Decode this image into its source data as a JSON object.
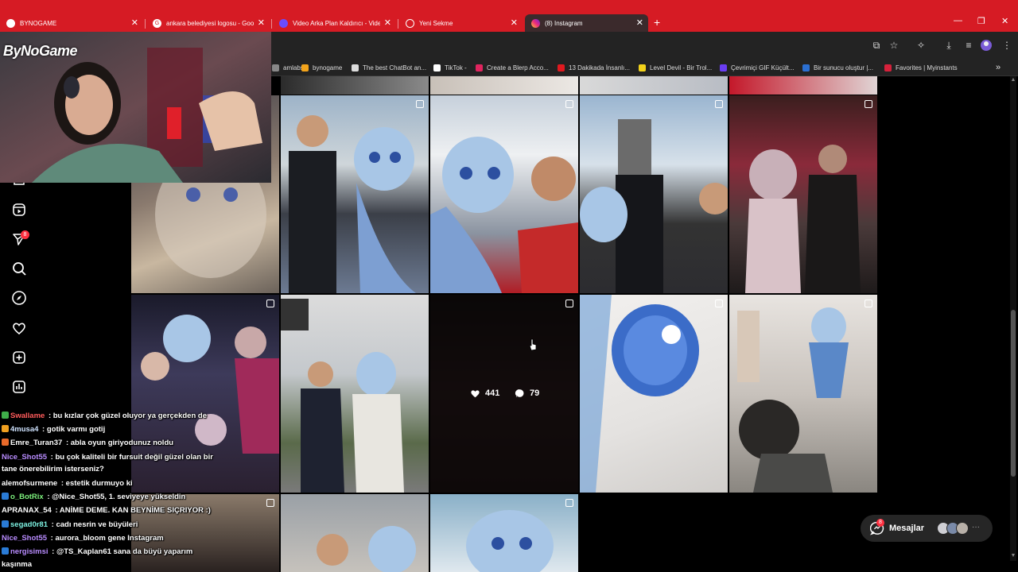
{
  "tabs": [
    {
      "label": "BYNOGAME",
      "active": false
    },
    {
      "label": "ankara belediyesi logosu - Goo",
      "active": false
    },
    {
      "label": "Video Arka Plan Kaldırıcı - Vide",
      "active": false
    },
    {
      "label": "Yeni Sekme",
      "active": false
    },
    {
      "label": "(8) Instagram",
      "active": true
    }
  ],
  "new_tab_label": "+",
  "window_controls": {
    "minimize": "—",
    "restore": "❐",
    "close": "✕"
  },
  "bookmarks": [
    {
      "label": "amlabs",
      "color": "#888888"
    },
    {
      "label": "bynogame",
      "color": "#f2a31b"
    },
    {
      "label": "The best ChatBot an...",
      "color": "#dddddd"
    },
    {
      "label": "TikTok -",
      "color": "#ffffff"
    },
    {
      "label": "Create a Blerp Acco...",
      "color": "#e0245e"
    },
    {
      "label": "13 Dakikada İnsanlı...",
      "color": "#e0191f"
    },
    {
      "label": "Level Devil - Bir Trol...",
      "color": "#f2d21b"
    },
    {
      "label": "Çevrimiçi GIF Küçült...",
      "color": "#6a3df2"
    },
    {
      "label": "Bir sunucu oluştur |...",
      "color": "#2b6fd1"
    },
    {
      "label": "Favorites | Myinstants",
      "color": "#d6213b"
    }
  ],
  "bookmarks_more": "»",
  "notifications_badge": "8",
  "post_stats": {
    "likes": "441",
    "comments": "79"
  },
  "messages": {
    "label": "Mesajlar",
    "badge": "8",
    "more": "···"
  },
  "logo_text": "ByNoGame",
  "chat": [
    {
      "user": "Swallame",
      "user_color": "#ff5b5b",
      "text": " : bu kızlar çok güzel oluyor ya gerçekden de",
      "tag_color": "#3fae4a"
    },
    {
      "user": "4musa4",
      "user_color": "#cfe3ff",
      "text": " : gotik varmı gotij",
      "tag_color": "#f0a020"
    },
    {
      "user": "Emre_Turan37",
      "user_color": "#ffffff",
      "text": " : abla oyun giriyodunuz noldu",
      "tag_color": "#e86a2a"
    },
    {
      "user": "Nice_Shot55",
      "user_color": "#b98cff",
      "text": " : bu çok kaliteli bir fursuit değil güzel olan bir",
      "tag_color": ""
    },
    {
      "user": "",
      "user_color": "#ffffff",
      "text": "tane önerebilirim isterseniz?",
      "tag_color": ""
    },
    {
      "user": "alemofsurmene",
      "user_color": "#ffffff",
      "text": " : estetik durmuyo ki",
      "tag_color": ""
    },
    {
      "user": "o_BotRix",
      "user_color": "#7cf07c",
      "text": " : @Nice_Shot55, 1. seviyeye yükseldin",
      "tag_color": "#2a7bd6"
    },
    {
      "user": "APRANAX_54",
      "user_color": "#ffffff",
      "text": " : ANİME DEME. KAN BEYNİME SIÇRIYOR :)",
      "tag_color": ""
    },
    {
      "user": "segad0r81",
      "user_color": "#7cf0e0",
      "text": " : cadı nesrin ve büyüleri",
      "tag_color": "#2a7bd6"
    },
    {
      "user": "Nice_Shot55",
      "user_color": "#b98cff",
      "text": " : aurora_bloom gene Instagram",
      "tag_color": ""
    },
    {
      "user": "nergisimsi",
      "user_color": "#b98cff",
      "text": " : @TS_Kaplan61 sana da büyü yaparım",
      "tag_color": "#2a7bd6"
    },
    {
      "user": "",
      "user_color": "#ffffff",
      "text": "kaşınma",
      "tag_color": ""
    }
  ]
}
